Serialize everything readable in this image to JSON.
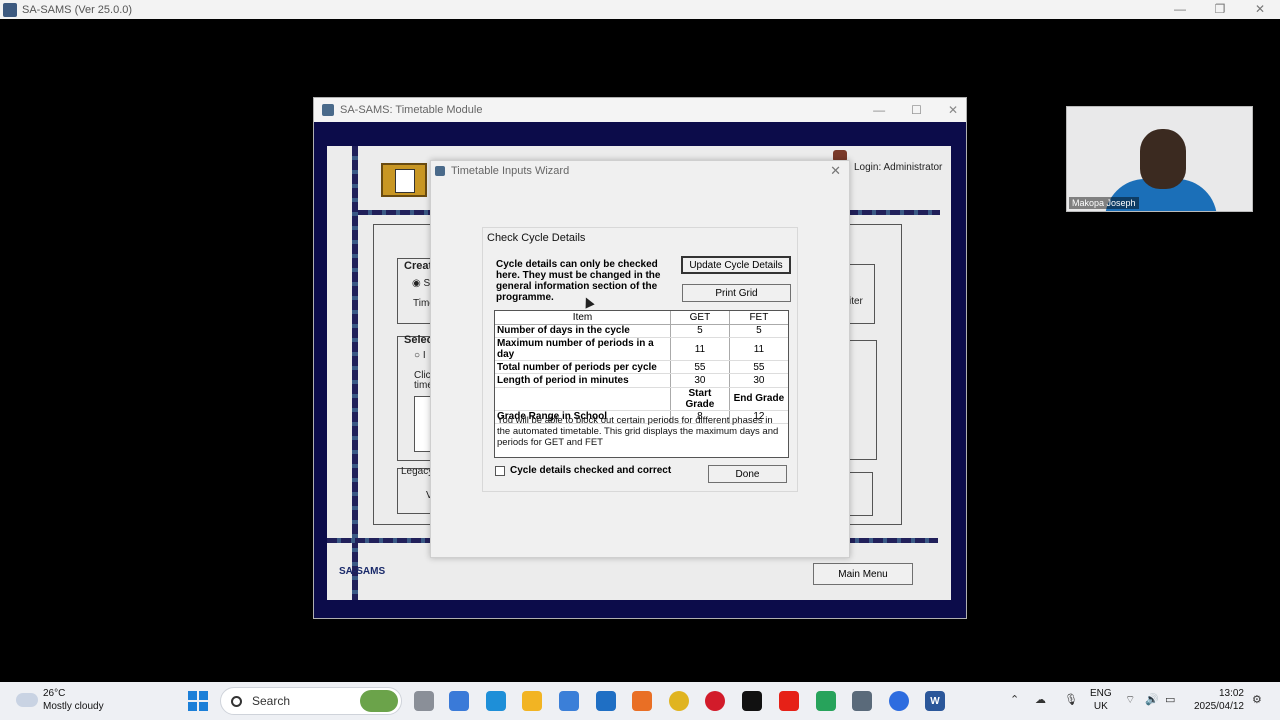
{
  "app": {
    "title": "SA-SAMS (Ver 25.0.0)"
  },
  "timetable_window": {
    "title": "SA-SAMS: Timetable Module",
    "login_label": "Login: Administrator",
    "brand_label": "SA-SAMS",
    "main_menu_label": "Main Menu",
    "bg_labels": {
      "create": "Creat",
      "time": "Time",
      "select": "Selec",
      "click": "Click",
      "time2": "time",
      "legacy": "Legacy",
      "v": "V",
      "iter": "iter"
    }
  },
  "wizard": {
    "title": "Timetable Inputs Wizard",
    "group_label": "Check Cycle Details",
    "notice": "Cycle details can only be checked here. They must be changed in the general information section of the programme.",
    "update_button": "Update Cycle Details",
    "print_button": "Print Grid",
    "grid": {
      "headers": [
        "Item",
        "GET",
        "FET"
      ],
      "rows": [
        {
          "item": "Number of days in the cycle",
          "get": "5",
          "fet": "5"
        },
        {
          "item": "Maximum number of periods in a day",
          "get": "11",
          "fet": "11"
        },
        {
          "item": "Total number of periods per cycle",
          "get": "55",
          "fet": "55"
        },
        {
          "item": "Length of period in minutes",
          "get": "30",
          "fet": "30"
        }
      ],
      "grade_headers": [
        "Start Grade",
        "End Grade"
      ],
      "grade_row": {
        "item": "Grade Range in School",
        "start": "8",
        "end": "12"
      },
      "note": "You will be able to block out certain periods for different phases in the automated timetable. This grid displays the maximum days and periods for GET and FET"
    },
    "checkbox_label": "Cycle details checked and correct",
    "done_button": "Done"
  },
  "webcam": {
    "name": "Makopa Joseph"
  },
  "taskbar": {
    "weather_temp": "26°C",
    "weather_desc": "Mostly cloudy",
    "search_placeholder": "Search",
    "lang_top": "ENG",
    "lang_bottom": "UK",
    "time": "13:02",
    "date": "2025/04/12"
  }
}
